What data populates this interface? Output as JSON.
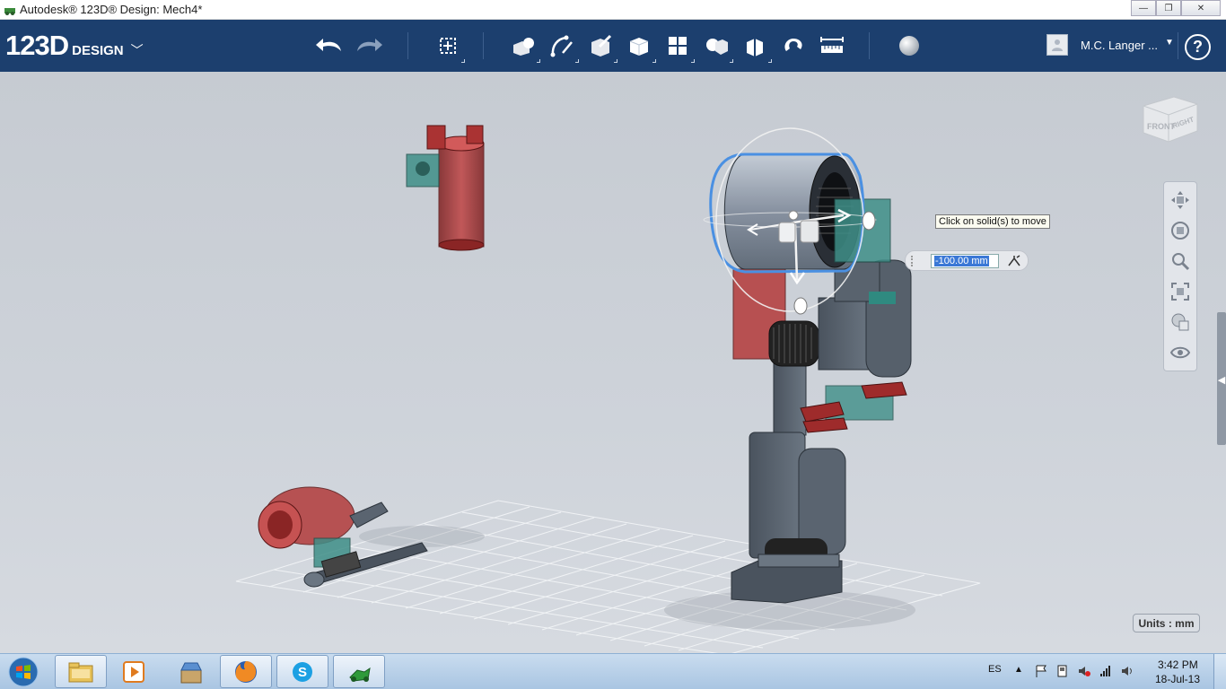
{
  "window": {
    "title": "Autodesk® 123D® Design: Mech4*",
    "icon": "app-logo-icon",
    "buttons": [
      "minimize",
      "restore",
      "close"
    ]
  },
  "toolbar": {
    "logo_number": "123D",
    "logo_word": "DESIGN",
    "user_name": "M.C. Langer ...",
    "help_label": "?",
    "tools": [
      {
        "name": "undo",
        "icon": "undo-icon"
      },
      {
        "name": "redo",
        "icon": "redo-icon"
      },
      {
        "name": "transform",
        "icon": "transform-icon"
      },
      {
        "name": "primitives",
        "icon": "primitives-icon"
      },
      {
        "name": "sketch",
        "icon": "sketch-icon"
      },
      {
        "name": "construct",
        "icon": "construct-icon"
      },
      {
        "name": "modify",
        "icon": "modify-icon"
      },
      {
        "name": "pattern",
        "icon": "pattern-icon"
      },
      {
        "name": "grouping",
        "icon": "grouping-icon"
      },
      {
        "name": "combine",
        "icon": "combine-icon"
      },
      {
        "name": "snap",
        "icon": "snap-icon"
      },
      {
        "name": "measure",
        "icon": "measure-icon"
      },
      {
        "name": "material",
        "icon": "material-icon"
      }
    ]
  },
  "viewport": {
    "tooltip": "Click on solid(s) to move",
    "distance_value": "-100.00 mm",
    "viewcube_front": "FRONT",
    "viewcube_right": "RIGHT",
    "units": "Units : mm"
  },
  "navbar": [
    "pan-icon",
    "orbit-icon",
    "zoom-icon",
    "fit-icon",
    "view-style-icon",
    "visibility-icon"
  ],
  "taskbar": {
    "apps": [
      "file-explorer-icon",
      "media-player-icon",
      "store-icon",
      "firefox-icon",
      "skype-icon",
      "123d-design-icon"
    ],
    "language": "ES",
    "time": "3:42 PM",
    "date": "18-Jul-13"
  },
  "colors": {
    "toolbar_bg": "#1c3f6e",
    "selection": "#4a90e2",
    "part_red": "#9e2b2b",
    "part_gray": "#5a6470",
    "part_teal": "#3f8f88"
  }
}
